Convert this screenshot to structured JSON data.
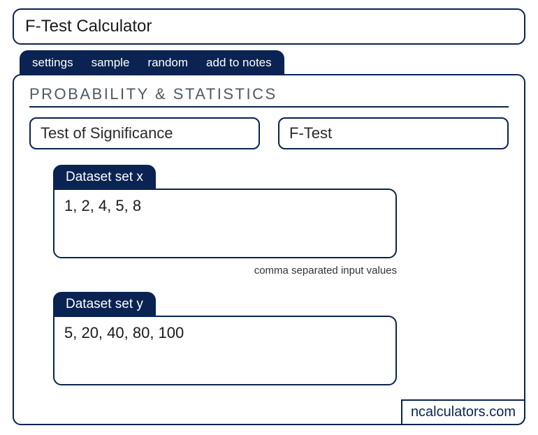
{
  "title": "F-Test Calculator",
  "tabs": {
    "settings": "settings",
    "sample": "sample",
    "random": "random",
    "add_to_notes": "add to notes"
  },
  "section_heading": "PROBABILITY & STATISTICS",
  "selectors": {
    "category": "Test of Significance",
    "method": "F-Test"
  },
  "datasets": {
    "x": {
      "label": "Dataset set x",
      "value": "1, 2, 4, 5, 8"
    },
    "y": {
      "label": "Dataset set y",
      "value": "5, 20, 40, 80, 100"
    }
  },
  "helper": "comma separated input values",
  "brand": "ncalculators.com"
}
